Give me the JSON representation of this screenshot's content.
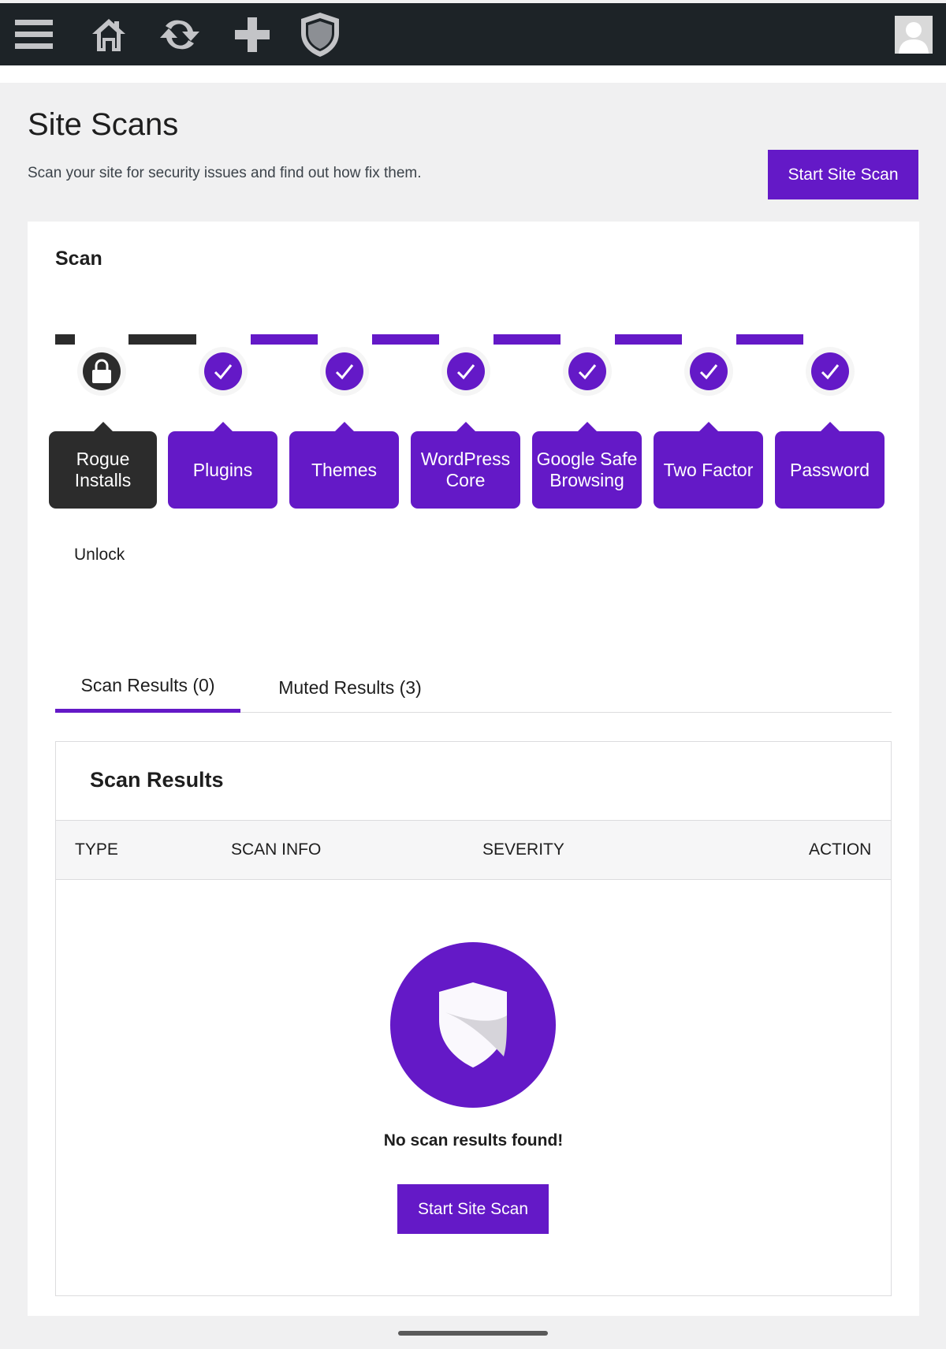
{
  "toolbar": {
    "icons": [
      "menu-icon",
      "home-icon",
      "refresh-icon",
      "plus-icon",
      "shield-icon",
      "avatar"
    ]
  },
  "page": {
    "title": "Site Scans",
    "description": "Scan your site for security issues and find out how fix them.",
    "start_scan_label": "Start Site Scan"
  },
  "scan": {
    "title": "Scan",
    "steps": [
      {
        "label": "Rogue Installs",
        "status": "locked"
      },
      {
        "label": "Plugins",
        "status": "complete"
      },
      {
        "label": "Themes",
        "status": "complete"
      },
      {
        "label": "WordPress Core",
        "status": "complete"
      },
      {
        "label": "Google Safe Browsing",
        "status": "complete"
      },
      {
        "label": "Two Factor",
        "status": "complete"
      },
      {
        "label": "Password",
        "status": "complete"
      }
    ],
    "unlock_label": "Unlock"
  },
  "tabs": [
    {
      "label": "Scan Results (0)",
      "active": true
    },
    {
      "label": "Muted Results (3)",
      "active": false
    }
  ],
  "results": {
    "title": "Scan Results",
    "columns": [
      "TYPE",
      "SCAN INFO",
      "SEVERITY",
      "ACTION"
    ],
    "empty_message": "No scan results found!",
    "start_scan_label": "Start Site Scan"
  },
  "colors": {
    "accent": "#6419c7",
    "topbar": "#1d2327",
    "locked": "#2c2c2c"
  }
}
